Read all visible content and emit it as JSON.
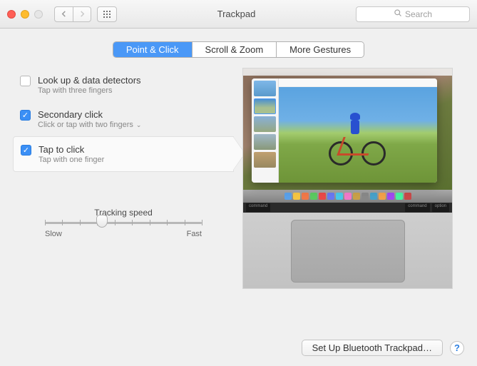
{
  "window": {
    "title": "Trackpad",
    "search_placeholder": "Search"
  },
  "tabs": [
    {
      "label": "Point & Click",
      "active": true
    },
    {
      "label": "Scroll & Zoom",
      "active": false
    },
    {
      "label": "More Gestures",
      "active": false
    }
  ],
  "options": [
    {
      "title": "Look up & data detectors",
      "subtitle": "Tap with three fingers",
      "checked": false,
      "has_dropdown": false,
      "selected": false
    },
    {
      "title": "Secondary click",
      "subtitle": "Click or tap with two fingers",
      "checked": true,
      "has_dropdown": true,
      "selected": false
    },
    {
      "title": "Tap to click",
      "subtitle": "Tap with one finger",
      "checked": true,
      "has_dropdown": false,
      "selected": true
    }
  ],
  "tracking": {
    "label": "Tracking speed",
    "min_label": "Slow",
    "max_label": "Fast",
    "value": 3,
    "ticks": 10
  },
  "footer": {
    "bluetooth_button": "Set Up Bluetooth Trackpad…",
    "help": "?"
  },
  "keyboard_keys": {
    "left": "command",
    "right1": "command",
    "right2": "option"
  },
  "dock_colors": [
    "#5aa0e8",
    "#f5c542",
    "#f07848",
    "#5ac860",
    "#e84848",
    "#6878f0",
    "#48c8e8",
    "#f078c8",
    "#c8a048",
    "#888888",
    "#48a0c8",
    "#f0a048",
    "#a048f0",
    "#48f0a0",
    "#c84848"
  ]
}
